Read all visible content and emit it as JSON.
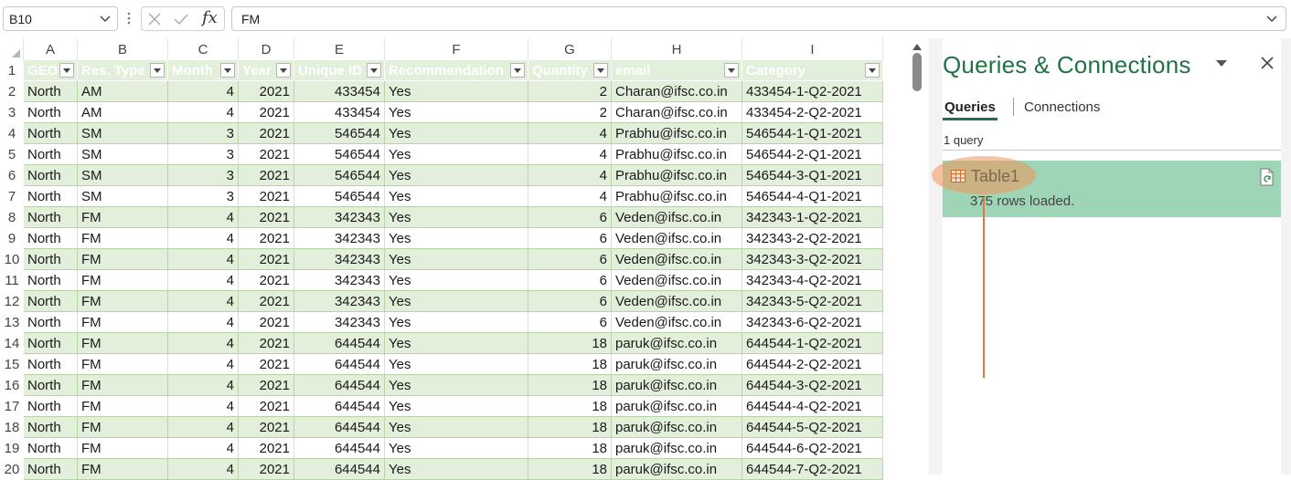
{
  "formula_bar": {
    "name_box": "B10",
    "formula": "FM",
    "fx_label": "fx"
  },
  "columns": [
    "A",
    "B",
    "C",
    "D",
    "E",
    "F",
    "G",
    "H",
    "I"
  ],
  "table": {
    "headers": [
      "GEO",
      "Res. Type",
      "Month",
      "Year",
      "Unique ID",
      "Recommendation",
      "Quantity",
      "email",
      "Category"
    ],
    "rows": [
      {
        "n": "2",
        "cells": [
          "North",
          "AM",
          "4",
          "2021",
          "433454",
          "Yes",
          "2",
          "Charan@ifsc.co.in",
          "433454-1-Q2-2021"
        ]
      },
      {
        "n": "3",
        "cells": [
          "North",
          "AM",
          "4",
          "2021",
          "433454",
          "Yes",
          "2",
          "Charan@ifsc.co.in",
          "433454-2-Q2-2021"
        ]
      },
      {
        "n": "4",
        "cells": [
          "North",
          "SM",
          "3",
          "2021",
          "546544",
          "Yes",
          "4",
          "Prabhu@ifsc.co.in",
          "546544-1-Q1-2021"
        ]
      },
      {
        "n": "5",
        "cells": [
          "North",
          "SM",
          "3",
          "2021",
          "546544",
          "Yes",
          "4",
          "Prabhu@ifsc.co.in",
          "546544-2-Q1-2021"
        ]
      },
      {
        "n": "6",
        "cells": [
          "North",
          "SM",
          "3",
          "2021",
          "546544",
          "Yes",
          "4",
          "Prabhu@ifsc.co.in",
          "546544-3-Q1-2021"
        ]
      },
      {
        "n": "7",
        "cells": [
          "North",
          "SM",
          "3",
          "2021",
          "546544",
          "Yes",
          "4",
          "Prabhu@ifsc.co.in",
          "546544-4-Q1-2021"
        ]
      },
      {
        "n": "8",
        "cells": [
          "North",
          "FM",
          "4",
          "2021",
          "342343",
          "Yes",
          "6",
          "Veden@ifsc.co.in",
          "342343-1-Q2-2021"
        ]
      },
      {
        "n": "9",
        "cells": [
          "North",
          "FM",
          "4",
          "2021",
          "342343",
          "Yes",
          "6",
          "Veden@ifsc.co.in",
          "342343-2-Q2-2021"
        ]
      },
      {
        "n": "10",
        "cells": [
          "North",
          "FM",
          "4",
          "2021",
          "342343",
          "Yes",
          "6",
          "Veden@ifsc.co.in",
          "342343-3-Q2-2021"
        ]
      },
      {
        "n": "11",
        "cells": [
          "North",
          "FM",
          "4",
          "2021",
          "342343",
          "Yes",
          "6",
          "Veden@ifsc.co.in",
          "342343-4-Q2-2021"
        ]
      },
      {
        "n": "12",
        "cells": [
          "North",
          "FM",
          "4",
          "2021",
          "342343",
          "Yes",
          "6",
          "Veden@ifsc.co.in",
          "342343-5-Q2-2021"
        ]
      },
      {
        "n": "13",
        "cells": [
          "North",
          "FM",
          "4",
          "2021",
          "342343",
          "Yes",
          "6",
          "Veden@ifsc.co.in",
          "342343-6-Q2-2021"
        ]
      },
      {
        "n": "14",
        "cells": [
          "North",
          "FM",
          "4",
          "2021",
          "644544",
          "Yes",
          "18",
          "paruk@ifsc.co.in",
          "644544-1-Q2-2021"
        ]
      },
      {
        "n": "15",
        "cells": [
          "North",
          "FM",
          "4",
          "2021",
          "644544",
          "Yes",
          "18",
          "paruk@ifsc.co.in",
          "644544-2-Q2-2021"
        ]
      },
      {
        "n": "16",
        "cells": [
          "North",
          "FM",
          "4",
          "2021",
          "644544",
          "Yes",
          "18",
          "paruk@ifsc.co.in",
          "644544-3-Q2-2021"
        ]
      },
      {
        "n": "17",
        "cells": [
          "North",
          "FM",
          "4",
          "2021",
          "644544",
          "Yes",
          "18",
          "paruk@ifsc.co.in",
          "644544-4-Q2-2021"
        ]
      },
      {
        "n": "18",
        "cells": [
          "North",
          "FM",
          "4",
          "2021",
          "644544",
          "Yes",
          "18",
          "paruk@ifsc.co.in",
          "644544-5-Q2-2021"
        ]
      },
      {
        "n": "19",
        "cells": [
          "North",
          "FM",
          "4",
          "2021",
          "644544",
          "Yes",
          "18",
          "paruk@ifsc.co.in",
          "644544-6-Q2-2021"
        ]
      },
      {
        "n": "20",
        "cells": [
          "North",
          "FM",
          "4",
          "2021",
          "644544",
          "Yes",
          "18",
          "paruk@ifsc.co.in",
          "644544-7-Q2-2021"
        ]
      }
    ]
  },
  "pane": {
    "title": "Queries & Connections",
    "tab_queries": "Queries",
    "tab_connections": "Connections",
    "query_count": "1 query",
    "query_name": "Table1",
    "query_status": "375 rows loaded."
  },
  "colors": {
    "header_green": "#70ad47",
    "band_green": "#e2efda",
    "excel_green": "#217346",
    "query_card": "#9fd5b7",
    "annotation_orange": "#e07a3c"
  }
}
